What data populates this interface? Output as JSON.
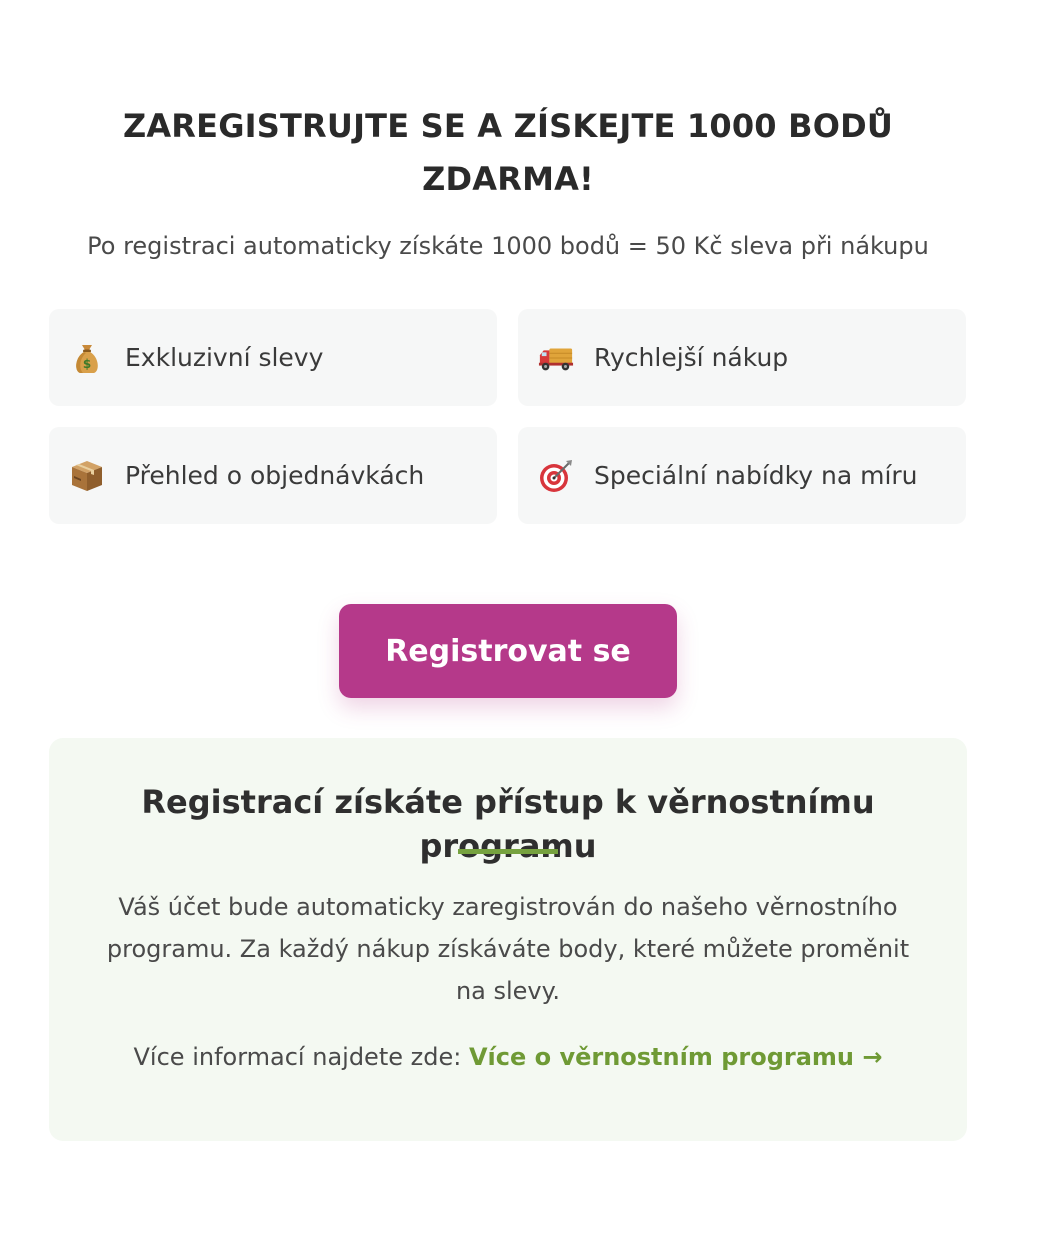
{
  "header": {
    "headline": "ZAREGISTRUJTE SE A ZÍSKEJTE 1000 BODŮ ZDARMA!",
    "subline": "Po registraci automaticky získáte 1000 bodů = 50 Kč sleva při nákupu"
  },
  "benefits": [
    {
      "icon": "money-bag-icon",
      "label": "Exkluzivní slevy"
    },
    {
      "icon": "delivery-truck-icon",
      "label": "Rychlejší nákup"
    },
    {
      "icon": "package-icon",
      "label": "Přehled o objednávkách"
    },
    {
      "icon": "target-icon",
      "label": "Speciální nabídky na míru"
    }
  ],
  "cta": {
    "label": "Registrovat se",
    "color": "#b5398a"
  },
  "info": {
    "title": "Registrací získáte přístup k věrnostnímu programu",
    "text": "Váš účet bude automaticky zaregistrován do našeho věrnostního programu. Za každý nákup získáváte body, které můžete proměnit na slevy.",
    "more_prefix": "Více informací najdete zde: ",
    "more_link": "Více o věrnostním programu →",
    "accent": "#6f9a35",
    "background": "#f4f9f2"
  }
}
